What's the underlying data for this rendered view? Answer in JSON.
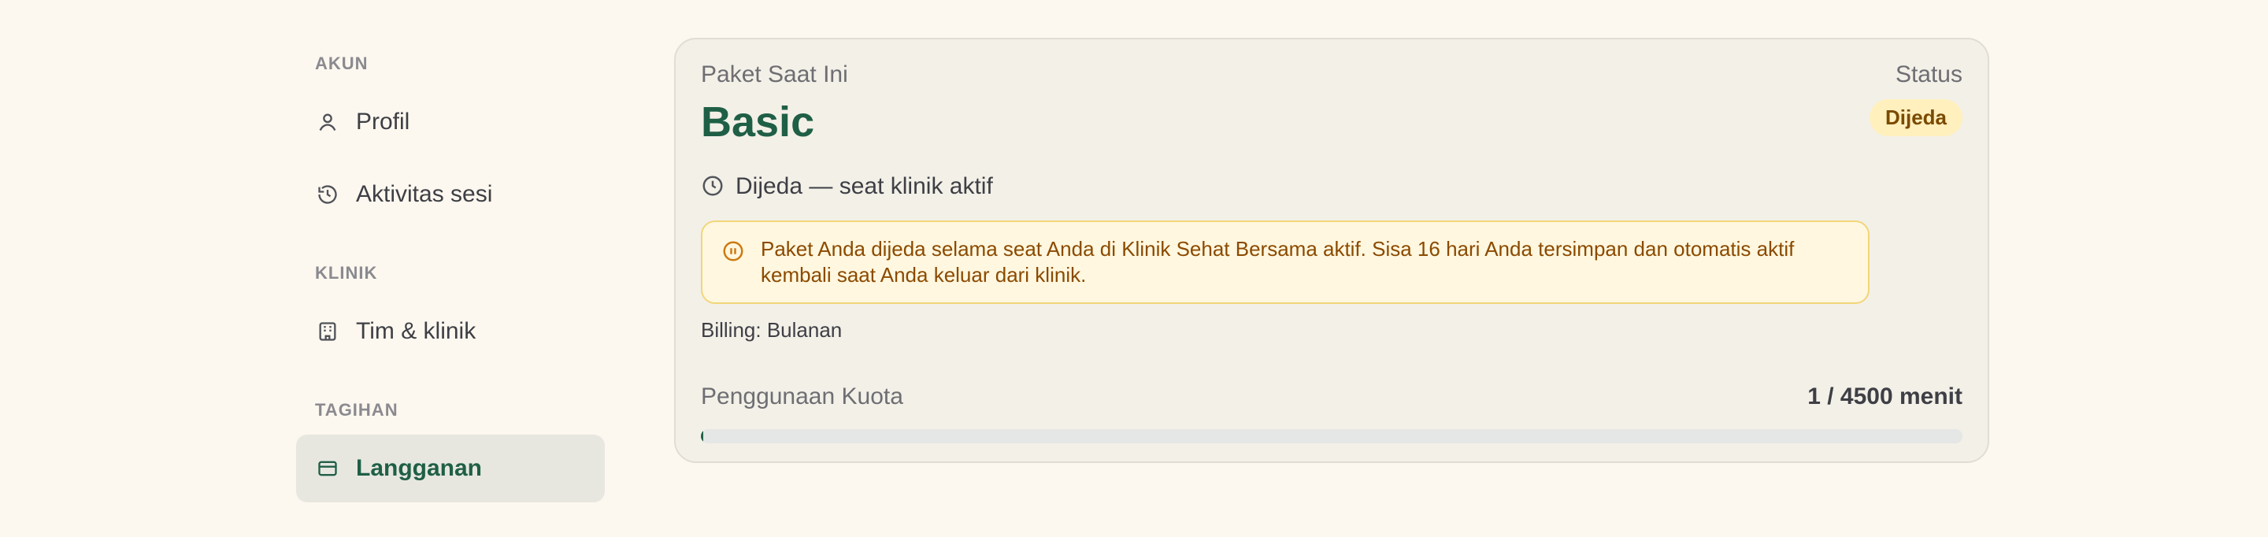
{
  "sidebar": {
    "sections": [
      {
        "title": "AKUN",
        "items": [
          {
            "label": "Profil",
            "icon": "user-icon",
            "active": false
          },
          {
            "label": "Aktivitas sesi",
            "icon": "history-icon",
            "active": false
          }
        ]
      },
      {
        "title": "KLINIK",
        "items": [
          {
            "label": "Tim & klinik",
            "icon": "building-icon",
            "active": false
          }
        ]
      },
      {
        "title": "TAGIHAN",
        "items": [
          {
            "label": "Langganan",
            "icon": "card-icon",
            "active": true
          }
        ]
      }
    ]
  },
  "subscription": {
    "current_label": "Paket Saat Ini",
    "plan_name": "Basic",
    "status_label": "Status",
    "status_badge": "Dijeda",
    "paused_text": "Dijeda — seat klinik aktif",
    "notice_text": "Paket Anda dijeda selama seat Anda di Klinik Sehat Bersama aktif. Sisa 16 hari Anda tersimpan dan otomatis aktif kembali saat Anda keluar dari klinik.",
    "billing_text": "Billing: Bulanan",
    "quota_title": "Penggunaan Kuota",
    "quota_value": "1 / 4500 menit",
    "quota_used": 1,
    "quota_total": 4500
  },
  "colors": {
    "accent": "#1f5f46",
    "warning_bg": "#fff7df",
    "warning_border": "#f2d679",
    "badge_bg": "#fff0bd"
  }
}
